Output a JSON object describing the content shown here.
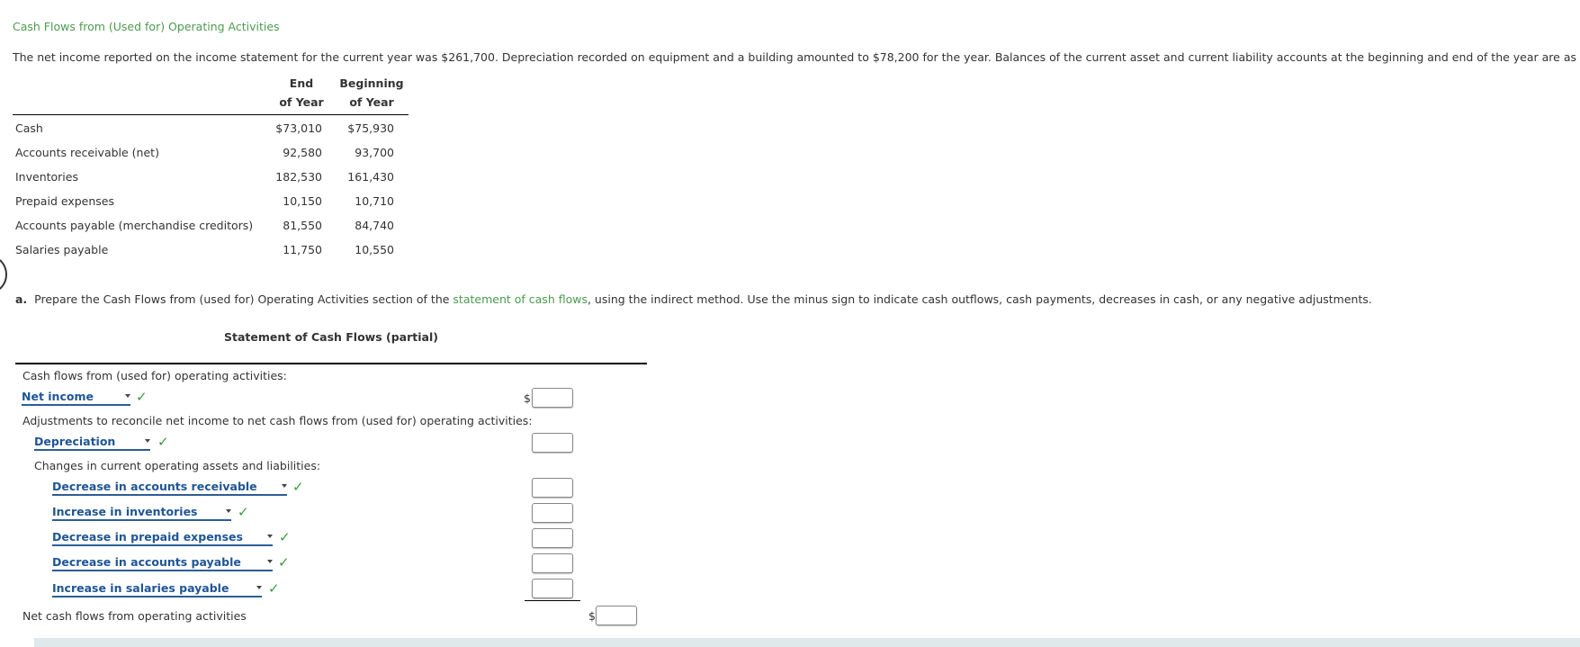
{
  "heading": "Cash Flows from (Used for) Operating Activities",
  "intro": "The net income reported on the income statement for the current year was $261,700. Depreciation recorded on equipment and a building amounted to $78,200 for the year. Balances of the current asset and current liability accounts at the beginning and end of the year are as follows:",
  "balances": {
    "headers": {
      "end_line1": "End",
      "end_line2": "of Year",
      "begin_line1": "Beginning",
      "begin_line2": "of Year"
    },
    "rows": [
      {
        "label": "Cash",
        "end": "$73,010",
        "begin": "$75,930"
      },
      {
        "label": "Accounts receivable (net)",
        "end": "92,580",
        "begin": "93,700"
      },
      {
        "label": "Inventories",
        "end": "182,530",
        "begin": "161,430"
      },
      {
        "label": "Prepaid expenses",
        "end": "10,150",
        "begin": "10,710"
      },
      {
        "label": "Accounts payable (merchandise creditors)",
        "end": "81,550",
        "begin": "84,740"
      },
      {
        "label": "Salaries payable",
        "end": "11,750",
        "begin": "10,550"
      }
    ]
  },
  "instruction": {
    "part": "a.",
    "before_link": "Prepare the Cash Flows from (used for) Operating Activities section of the ",
    "link": "statement of cash flows",
    "after_link": ", using the indirect method. Use the minus sign to indicate cash outflows, cash payments, decreases in cash, or any negative adjustments."
  },
  "statement": {
    "title": "Statement of Cash Flows (partial)",
    "section_label": "Cash flows from (used for) operating activities:",
    "adjustments_label": "Adjustments to reconcile net income to net cash flows from (used for) operating activities:",
    "changes_label": "Changes in current operating assets and liabilities:",
    "net_label": "Net cash flows from operating activities",
    "currency": "$",
    "check": "✓",
    "dropdowns": [
      {
        "selected": "Net income",
        "value": ""
      },
      {
        "selected": "Depreciation",
        "value": ""
      },
      {
        "selected": "Decrease in accounts receivable",
        "value": ""
      },
      {
        "selected": "Increase in inventories",
        "value": ""
      },
      {
        "selected": "Decrease in prepaid expenses",
        "value": ""
      },
      {
        "selected": "Decrease in accounts payable",
        "value": ""
      },
      {
        "selected": "Increase in salaries payable",
        "value": ""
      }
    ],
    "net_value": ""
  }
}
